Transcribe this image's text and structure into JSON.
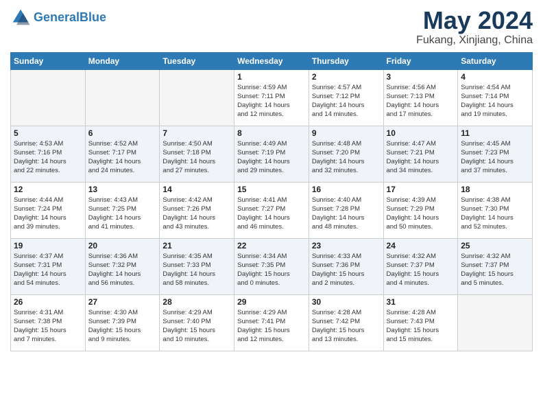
{
  "header": {
    "logo_general": "General",
    "logo_blue": "Blue",
    "month_title": "May 2024",
    "location": "Fukang, Xinjiang, China"
  },
  "days_of_week": [
    "Sunday",
    "Monday",
    "Tuesday",
    "Wednesday",
    "Thursday",
    "Friday",
    "Saturday"
  ],
  "weeks": [
    [
      {
        "day": "",
        "info": ""
      },
      {
        "day": "",
        "info": ""
      },
      {
        "day": "",
        "info": ""
      },
      {
        "day": "1",
        "info": "Sunrise: 4:59 AM\nSunset: 7:11 PM\nDaylight: 14 hours\nand 12 minutes."
      },
      {
        "day": "2",
        "info": "Sunrise: 4:57 AM\nSunset: 7:12 PM\nDaylight: 14 hours\nand 14 minutes."
      },
      {
        "day": "3",
        "info": "Sunrise: 4:56 AM\nSunset: 7:13 PM\nDaylight: 14 hours\nand 17 minutes."
      },
      {
        "day": "4",
        "info": "Sunrise: 4:54 AM\nSunset: 7:14 PM\nDaylight: 14 hours\nand 19 minutes."
      }
    ],
    [
      {
        "day": "5",
        "info": "Sunrise: 4:53 AM\nSunset: 7:16 PM\nDaylight: 14 hours\nand 22 minutes."
      },
      {
        "day": "6",
        "info": "Sunrise: 4:52 AM\nSunset: 7:17 PM\nDaylight: 14 hours\nand 24 minutes."
      },
      {
        "day": "7",
        "info": "Sunrise: 4:50 AM\nSunset: 7:18 PM\nDaylight: 14 hours\nand 27 minutes."
      },
      {
        "day": "8",
        "info": "Sunrise: 4:49 AM\nSunset: 7:19 PM\nDaylight: 14 hours\nand 29 minutes."
      },
      {
        "day": "9",
        "info": "Sunrise: 4:48 AM\nSunset: 7:20 PM\nDaylight: 14 hours\nand 32 minutes."
      },
      {
        "day": "10",
        "info": "Sunrise: 4:47 AM\nSunset: 7:21 PM\nDaylight: 14 hours\nand 34 minutes."
      },
      {
        "day": "11",
        "info": "Sunrise: 4:45 AM\nSunset: 7:23 PM\nDaylight: 14 hours\nand 37 minutes."
      }
    ],
    [
      {
        "day": "12",
        "info": "Sunrise: 4:44 AM\nSunset: 7:24 PM\nDaylight: 14 hours\nand 39 minutes."
      },
      {
        "day": "13",
        "info": "Sunrise: 4:43 AM\nSunset: 7:25 PM\nDaylight: 14 hours\nand 41 minutes."
      },
      {
        "day": "14",
        "info": "Sunrise: 4:42 AM\nSunset: 7:26 PM\nDaylight: 14 hours\nand 43 minutes."
      },
      {
        "day": "15",
        "info": "Sunrise: 4:41 AM\nSunset: 7:27 PM\nDaylight: 14 hours\nand 46 minutes."
      },
      {
        "day": "16",
        "info": "Sunrise: 4:40 AM\nSunset: 7:28 PM\nDaylight: 14 hours\nand 48 minutes."
      },
      {
        "day": "17",
        "info": "Sunrise: 4:39 AM\nSunset: 7:29 PM\nDaylight: 14 hours\nand 50 minutes."
      },
      {
        "day": "18",
        "info": "Sunrise: 4:38 AM\nSunset: 7:30 PM\nDaylight: 14 hours\nand 52 minutes."
      }
    ],
    [
      {
        "day": "19",
        "info": "Sunrise: 4:37 AM\nSunset: 7:31 PM\nDaylight: 14 hours\nand 54 minutes."
      },
      {
        "day": "20",
        "info": "Sunrise: 4:36 AM\nSunset: 7:32 PM\nDaylight: 14 hours\nand 56 minutes."
      },
      {
        "day": "21",
        "info": "Sunrise: 4:35 AM\nSunset: 7:33 PM\nDaylight: 14 hours\nand 58 minutes."
      },
      {
        "day": "22",
        "info": "Sunrise: 4:34 AM\nSunset: 7:35 PM\nDaylight: 15 hours\nand 0 minutes."
      },
      {
        "day": "23",
        "info": "Sunrise: 4:33 AM\nSunset: 7:36 PM\nDaylight: 15 hours\nand 2 minutes."
      },
      {
        "day": "24",
        "info": "Sunrise: 4:32 AM\nSunset: 7:37 PM\nDaylight: 15 hours\nand 4 minutes."
      },
      {
        "day": "25",
        "info": "Sunrise: 4:32 AM\nSunset: 7:37 PM\nDaylight: 15 hours\nand 5 minutes."
      }
    ],
    [
      {
        "day": "26",
        "info": "Sunrise: 4:31 AM\nSunset: 7:38 PM\nDaylight: 15 hours\nand 7 minutes."
      },
      {
        "day": "27",
        "info": "Sunrise: 4:30 AM\nSunset: 7:39 PM\nDaylight: 15 hours\nand 9 minutes."
      },
      {
        "day": "28",
        "info": "Sunrise: 4:29 AM\nSunset: 7:40 PM\nDaylight: 15 hours\nand 10 minutes."
      },
      {
        "day": "29",
        "info": "Sunrise: 4:29 AM\nSunset: 7:41 PM\nDaylight: 15 hours\nand 12 minutes."
      },
      {
        "day": "30",
        "info": "Sunrise: 4:28 AM\nSunset: 7:42 PM\nDaylight: 15 hours\nand 13 minutes."
      },
      {
        "day": "31",
        "info": "Sunrise: 4:28 AM\nSunset: 7:43 PM\nDaylight: 15 hours\nand 15 minutes."
      },
      {
        "day": "",
        "info": ""
      }
    ]
  ]
}
